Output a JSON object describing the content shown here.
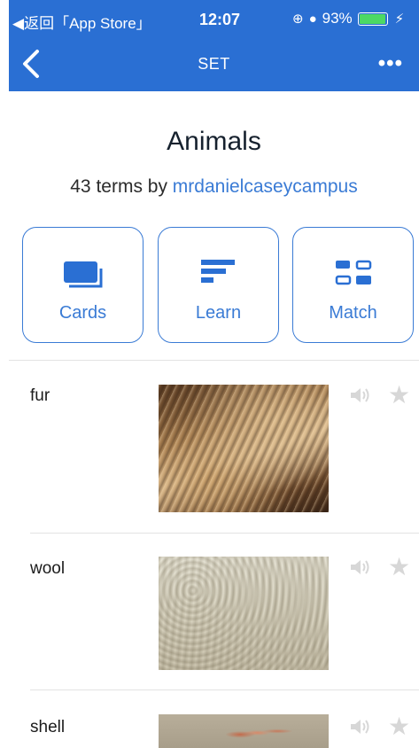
{
  "status_bar": {
    "back_app": "◀返回「App Store」",
    "time": "12:07",
    "battery": "93%",
    "battery_level": 0.93
  },
  "nav": {
    "title": "SET",
    "back_icon": "chevron-left-icon",
    "more_icon": "more-dots-icon",
    "more_label": "•••"
  },
  "set": {
    "title": "Animals",
    "terms_prefix": "43 terms by ",
    "author": "mrdanielcaseycampus"
  },
  "modes": [
    {
      "label": "Cards",
      "icon": "cards-icon"
    },
    {
      "label": "Learn",
      "icon": "learn-icon"
    },
    {
      "label": "Match",
      "icon": "match-icon"
    }
  ],
  "terms": [
    {
      "word": "fur",
      "image": "fur-texture"
    },
    {
      "word": "wool",
      "image": "wool-texture"
    },
    {
      "word": "shell",
      "image": "shell-photo"
    }
  ],
  "icons": {
    "speaker": "speaker-icon",
    "star": "star-icon"
  },
  "colors": {
    "nav_bg": "#2a6fd3",
    "accent": "#3a7bd5",
    "star": "#d7d7d7"
  }
}
